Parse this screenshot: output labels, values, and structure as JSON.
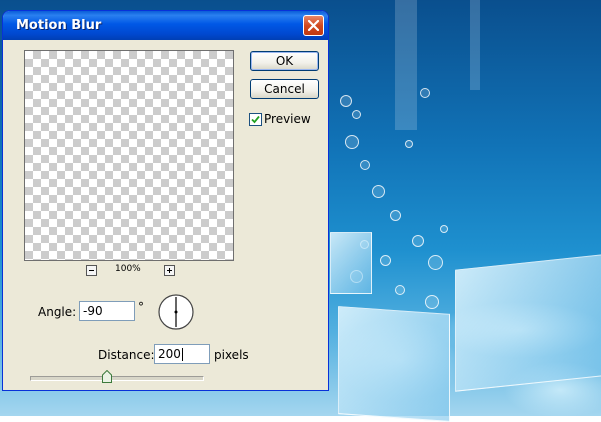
{
  "dialog": {
    "title": "Motion Blur",
    "buttons": {
      "ok": "OK",
      "cancel": "Cancel"
    },
    "preview_checkbox": {
      "label": "Preview",
      "checked": true
    },
    "zoom": {
      "level": "100%",
      "zoom_out_icon": "minus-icon",
      "zoom_in_icon": "plus-icon"
    },
    "angle": {
      "label": "Angle:",
      "value": "-90",
      "unit": "°",
      "dial_icon": "angle-dial-icon"
    },
    "distance": {
      "label": "Distance:",
      "value": "200",
      "unit": "pixels",
      "slider_fraction": 0.45
    }
  },
  "colors": {
    "titlebar": "#0058e6",
    "dialog_background": "#ece9d8",
    "close_button": "#d1491f",
    "checkmark": "#21a121"
  }
}
